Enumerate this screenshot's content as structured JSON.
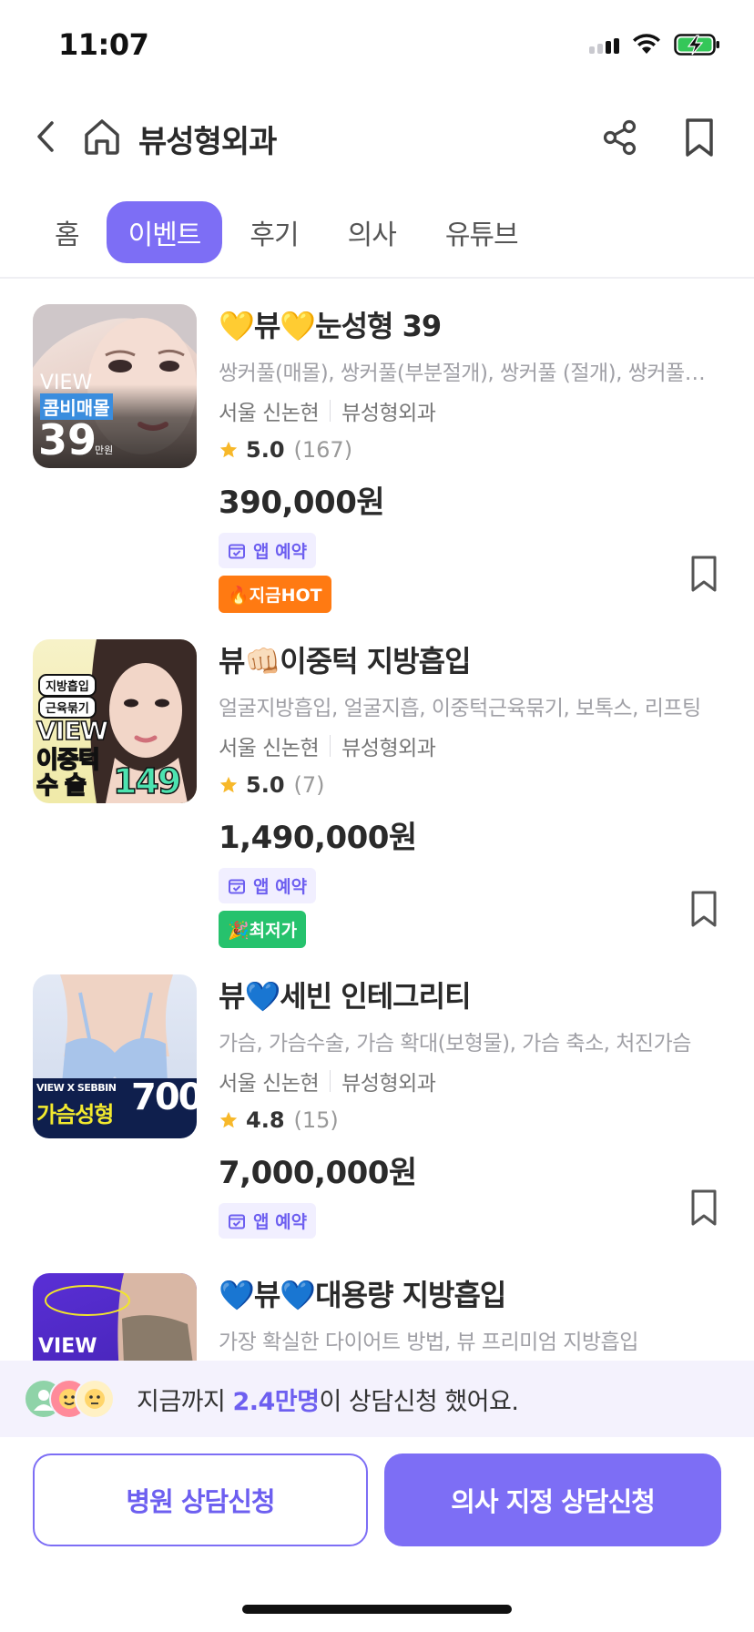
{
  "status_bar": {
    "time": "11:07"
  },
  "header": {
    "title": "뷰성형외과"
  },
  "tabs": [
    {
      "label": "홈",
      "active": false
    },
    {
      "label": "이벤트",
      "active": true
    },
    {
      "label": "후기",
      "active": false
    },
    {
      "label": "의사",
      "active": false
    },
    {
      "label": "유튜브",
      "active": false
    }
  ],
  "colors": {
    "accent": "#7d6ef5",
    "accent_text": "#6d5ff0",
    "star": "#f7b82a",
    "hot": "#ff7a12",
    "lowest": "#26c26d"
  },
  "items": [
    {
      "title": "💛뷰💛눈성형 39",
      "tags": "쌍커풀(매몰), 쌍커풀(부분절개), 쌍커풀 (절개), 쌍커풀 재수술, 눈매교정",
      "city": "서울 신논현",
      "hospital": "뷰성형외과",
      "rating": "5.0",
      "review_count": "(167)",
      "price": "390,000원",
      "app_badge": "앱 예약",
      "promo": "🔥지금HOT",
      "promo_type": "hot",
      "thumb": {
        "line1": "VIEW",
        "line2": "콤비매몰",
        "big": "39",
        "unit": "만원"
      }
    },
    {
      "title": "뷰👊🏻이중턱 지방흡입",
      "tags": "얼굴지방흡입, 얼굴지흡, 이중턱근육묶기, 보톡스, 리프팅",
      "city": "서울 신논현",
      "hospital": "뷰성형외과",
      "rating": "5.0",
      "review_count": "(7)",
      "price": "1,490,000원",
      "app_badge": "앱 예약",
      "promo": "🎉최저가",
      "promo_type": "lowest",
      "thumb": {
        "tag1": "지방흡입",
        "tag2": "근육묶기",
        "line1": "VIEW",
        "line2": "이중턱",
        "line3": "수 술",
        "big": "149"
      }
    },
    {
      "title": "뷰💙세빈 인테그리티",
      "tags": "가슴, 가슴수술, 가슴 확대(보형물), 가슴 축소, 처진가슴",
      "city": "서울 신논현",
      "hospital": "뷰성형외과",
      "rating": "4.8",
      "review_count": "(15)",
      "price": "7,000,000원",
      "app_badge": "앱 예약",
      "thumb": {
        "line1": "VIEW X SEBBIN",
        "line2": "가슴성형",
        "big": "700"
      }
    },
    {
      "title": "💙뷰💙대용량 지방흡입",
      "tags": "가장 확실한 다이어트 방법, 뷰 프리미엄 지방흡입",
      "thumb": {
        "line1": "VIEW"
      }
    }
  ],
  "consult": {
    "prefix": "지금까지 ",
    "highlight": "2.4만명",
    "suffix": "이 상담신청 했어요."
  },
  "buttons": {
    "hospital": "병원 상담신청",
    "doctor": "의사 지정 상담신청"
  }
}
